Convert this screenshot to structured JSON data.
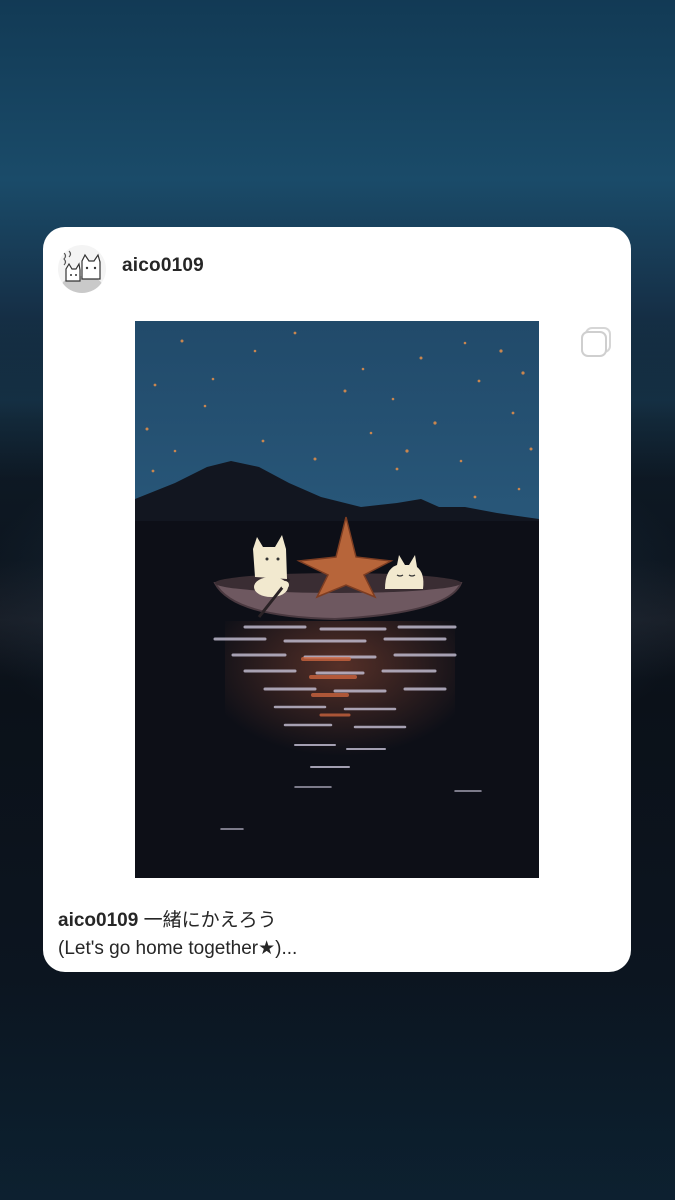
{
  "post": {
    "username": "aico0109",
    "caption_user": "aico0109",
    "caption_line1": " 一緒にかえろう",
    "caption_line2": "(Let's go home together★)..."
  },
  "icons": {
    "avatar": "cat-avatar-icon",
    "multi": "multiple-images-icon"
  },
  "colors": {
    "card": "#ffffff",
    "text": "#262626",
    "sky": "#2a5b7e",
    "water": "#0d0f17",
    "star": "#b7653a"
  }
}
